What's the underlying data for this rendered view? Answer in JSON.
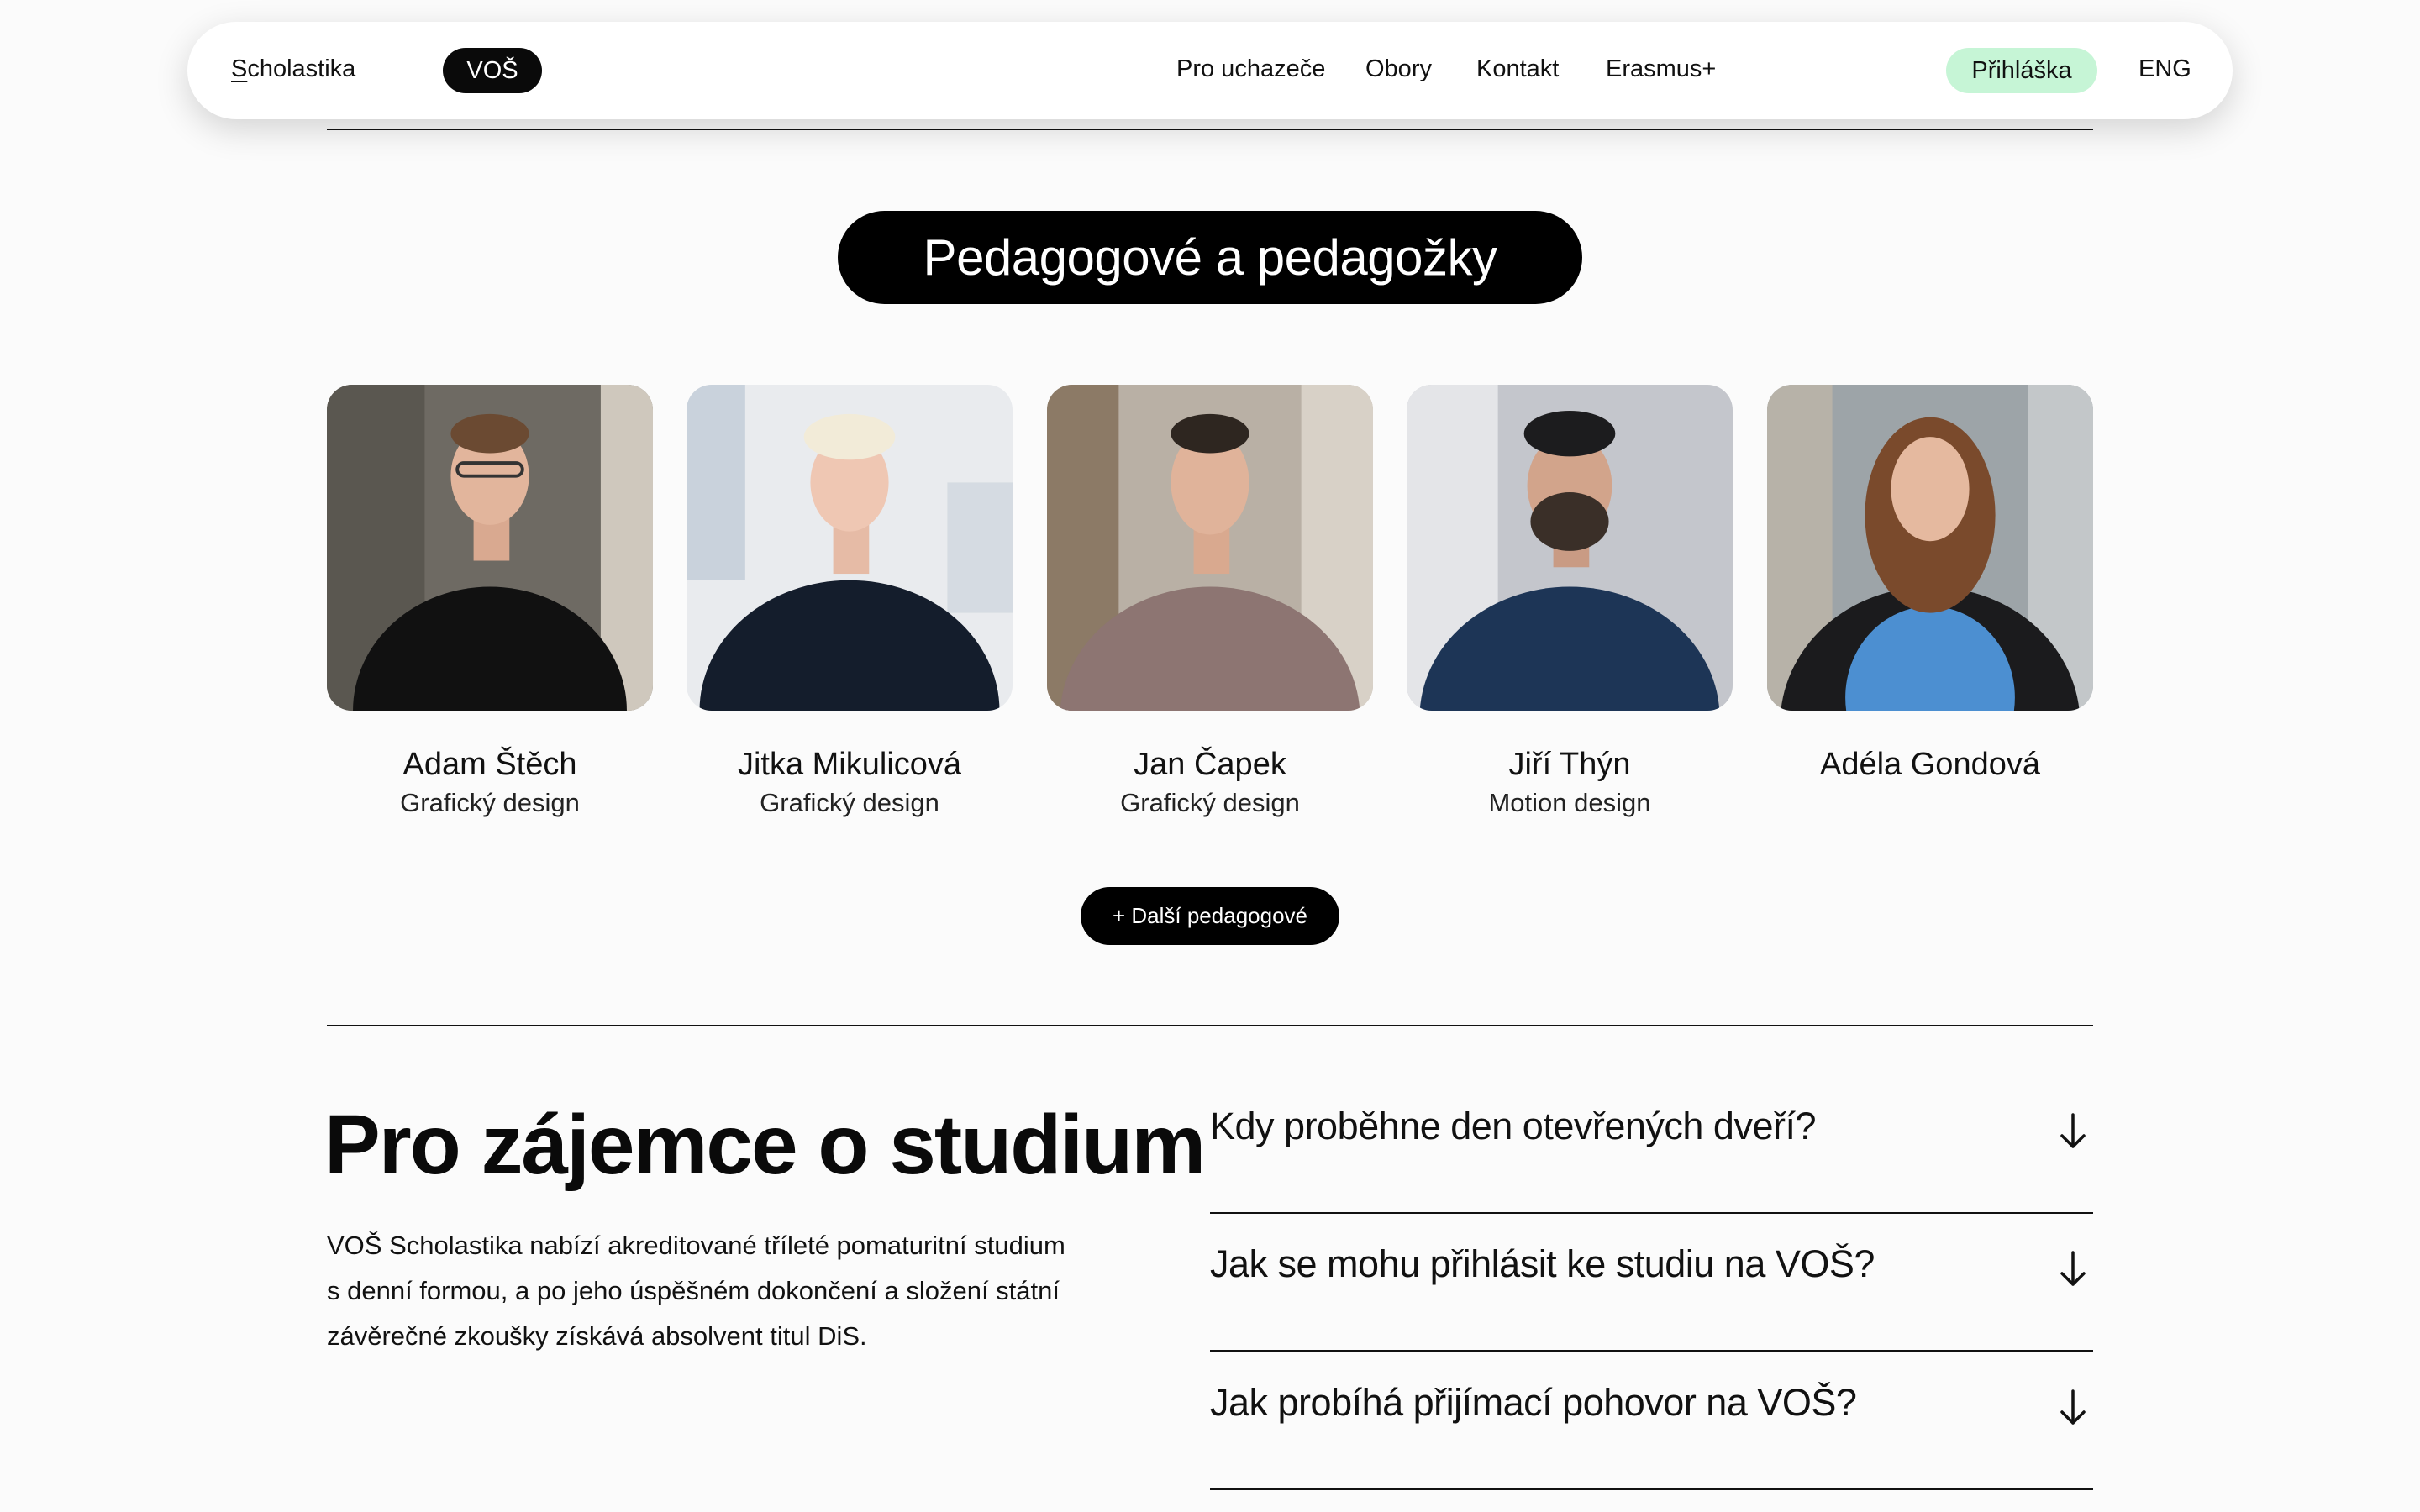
{
  "header": {
    "brand_first_letter": "S",
    "brand_rest": "cholastika",
    "section_pill": "VOŠ",
    "nav": [
      "Pro uchazeče",
      "Obory",
      "Kontakt",
      "Erasmus+"
    ],
    "apply_label": "Přihláška",
    "lang_label": "ENG"
  },
  "teachers_section": {
    "title": "Pedagogové a pedagožky",
    "teachers": [
      {
        "name": "Adam Štěch",
        "role": "Grafický design"
      },
      {
        "name": "Jitka Mikulicová",
        "role": "Grafický design"
      },
      {
        "name": "Jan Čapek",
        "role": "Grafický design"
      },
      {
        "name": "Jiří Thýn",
        "role": "Motion design"
      },
      {
        "name": "Adéla Gondová",
        "role": ""
      }
    ],
    "more_label": "+ Další pedagogové"
  },
  "study": {
    "title": "Pro zájemce o studium",
    "intro_lines": [
      "VOŠ Scholastika nabízí akreditované tříleté pomaturitní studium",
      "s denní formou, a po jeho úspěšném dokončení a složení státní",
      "závěrečné zkoušky získává absolvent titul DiS."
    ],
    "faq": [
      {
        "question": "Kdy proběhne den otevřených dveří?",
        "icon": "arrow-down-icon"
      },
      {
        "question": "Jak se mohu přihlásit ke studiu na VOŠ?",
        "icon": "arrow-down-icon"
      },
      {
        "question": "Jak probíhá přijímací pohovor na VOŠ?",
        "icon": "arrow-down-icon"
      }
    ]
  },
  "colors": {
    "background": "#fbfbfb",
    "dark": "#000000",
    "apply_accent": "#c6f5d6"
  }
}
